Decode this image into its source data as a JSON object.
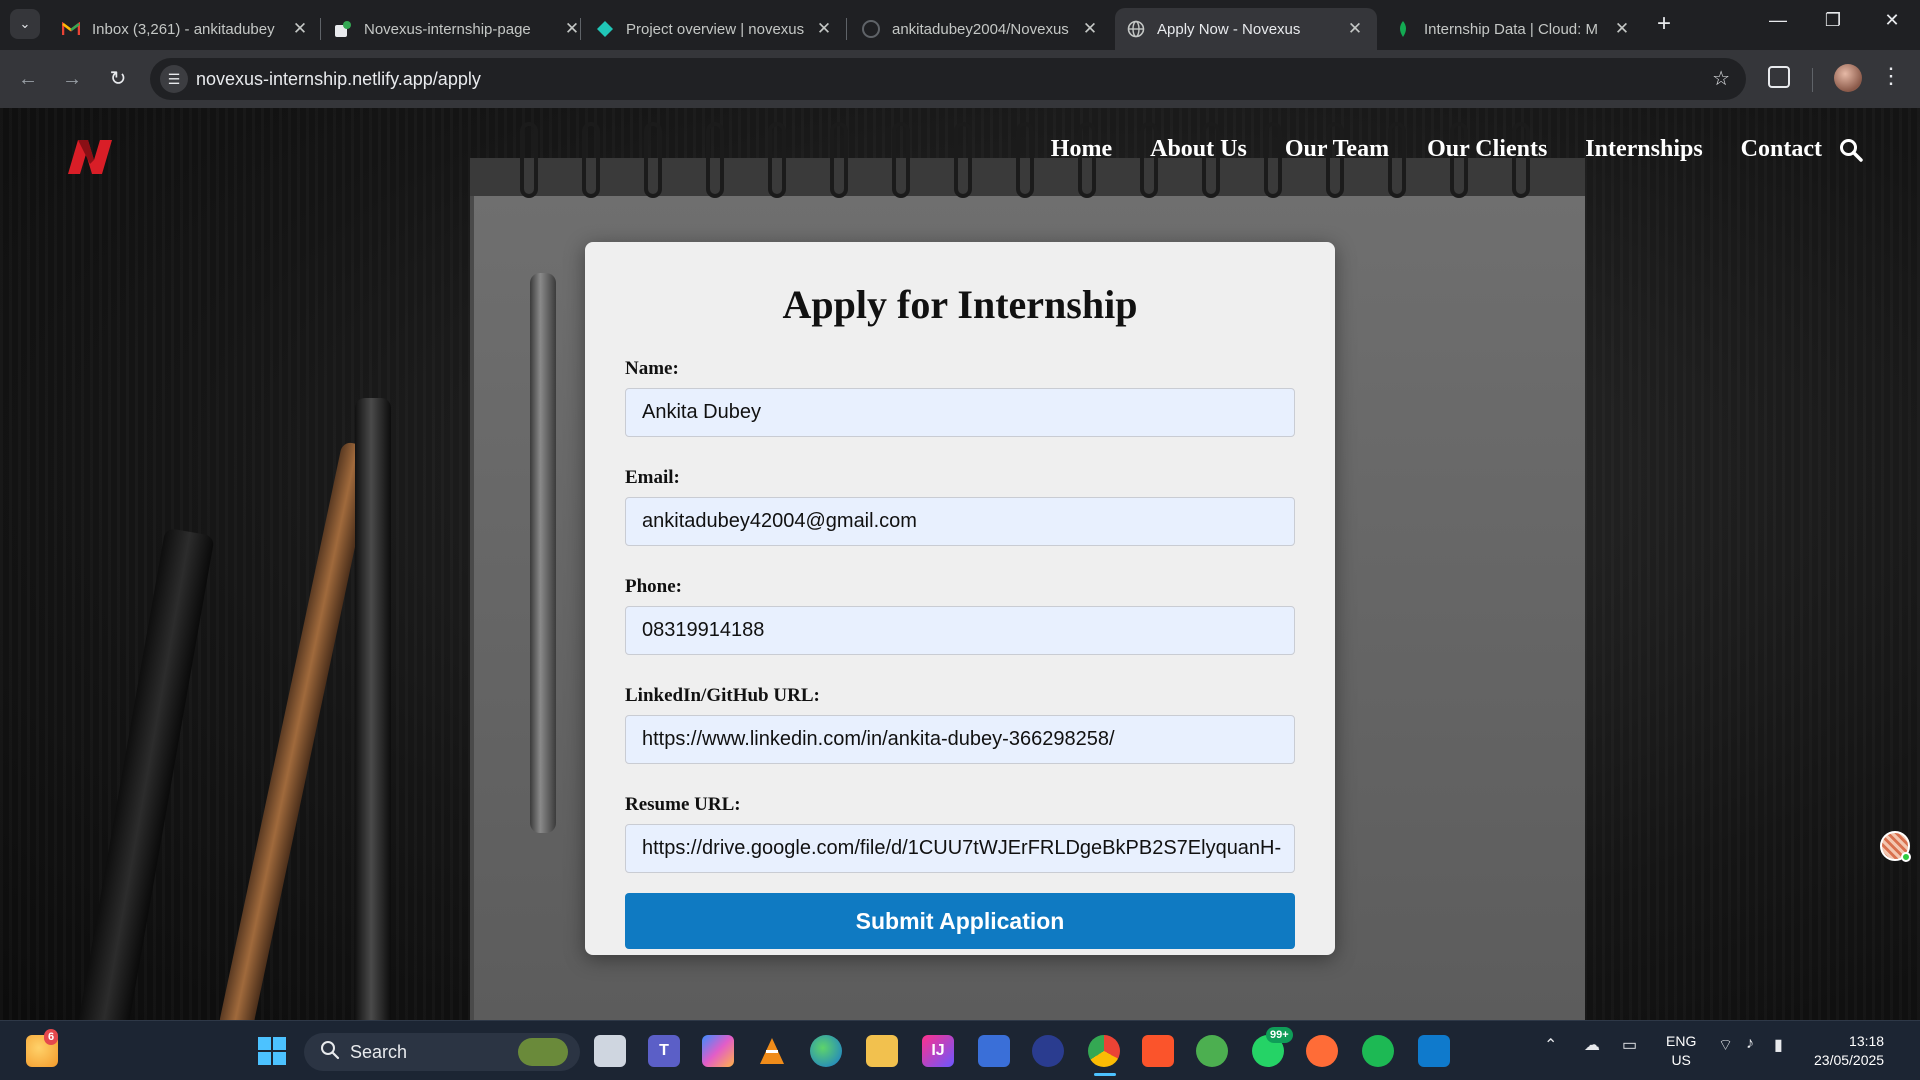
{
  "browser": {
    "tabs": [
      {
        "title": "Inbox (3,261) - ankitadubey",
        "icon": "gmail-icon"
      },
      {
        "title": "Novexus-internship-page",
        "icon": "netlify-icon"
      },
      {
        "title": "Project overview | novexus",
        "icon": "netlify-diamond-icon"
      },
      {
        "title": "ankitadubey2004/Novexus",
        "icon": "github-icon"
      },
      {
        "title": "Apply Now - Novexus",
        "icon": "globe-icon"
      },
      {
        "title": "Internship Data | Cloud: M",
        "icon": "mongodb-leaf-icon"
      }
    ],
    "active_tab_index": 4,
    "url": "novexus-internship.netlify.app/apply"
  },
  "site": {
    "logo_letter": "N",
    "nav": [
      "Home",
      "About Us",
      "Our Team",
      "Our Clients",
      "Internships",
      "Contact"
    ]
  },
  "form": {
    "title": "Apply for Internship",
    "fields": [
      {
        "label": "Name:",
        "value": "Ankita Dubey"
      },
      {
        "label": "Email:",
        "value": "ankitadubey42004@gmail.com"
      },
      {
        "label": "Phone:",
        "value": "08319914188"
      },
      {
        "label": "LinkedIn/GitHub URL:",
        "value": "https://www.linkedin.com/in/ankita-dubey-366298258/"
      },
      {
        "label": "Resume URL:",
        "value": "https://drive.google.com/file/d/1CUU7tWJErFRLDgeBkPB2S7ElyquanH-"
      }
    ],
    "submit_label": "Submit Application"
  },
  "taskbar": {
    "search_label": "Search",
    "weather_badge": "6",
    "whatsapp_badge": "99+",
    "lang_line1": "ENG",
    "lang_line2": "US",
    "time": "13:18",
    "date": "23/05/2025"
  },
  "colors": {
    "submit_bg": "#0f7ac2",
    "input_bg": "#e8f0fe",
    "card_bg": "#efefef",
    "logo_red": "#d91e27"
  }
}
